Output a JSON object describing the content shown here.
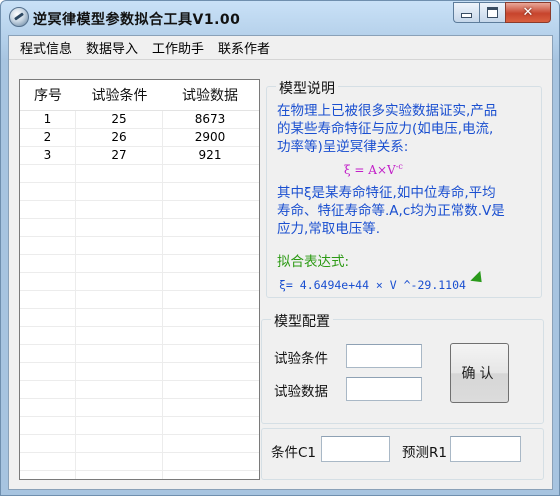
{
  "window": {
    "title": "逆冥律模型参数拟合工具V1.00",
    "close_glyph": "✕"
  },
  "menu": [
    "程式信息",
    "数据导入",
    "工作助手",
    "联系作者"
  ],
  "table": {
    "headers": [
      "序号",
      "试验条件",
      "试验数据"
    ],
    "rows": [
      [
        "1",
        "25",
        "8673"
      ],
      [
        "2",
        "26",
        "2900"
      ],
      [
        "3",
        "27",
        "921"
      ]
    ],
    "empty_rows": 18
  },
  "model_desc": {
    "group_title": "模型说明",
    "intro": [
      "在物理上已被很多实验数据证实,产品",
      "的某些寿命特征与应力(如电压,电流,",
      "功率等)呈逆冥律关系:"
    ],
    "formula": "ξ = A×V",
    "formula_exp": "-c",
    "explain": [
      "其中ξ是某寿命特征,如中位寿命,平均",
      "寿命、特征寿命等.A,c均为正常数.V是",
      "应力,常取电压等."
    ],
    "fit_label": "拟合表达式:",
    "fit_expr": "ξ= 4.6494e+44 × V ^-29.1104"
  },
  "model_config": {
    "group_title": "模型配置",
    "condition_label": "试验条件",
    "data_label": "试验数据",
    "condition_value": "",
    "data_value": "",
    "confirm_label": "确认"
  },
  "predict": {
    "condition_label": "条件C1",
    "predict_label": "预测R1",
    "condition_value": "",
    "predict_value": ""
  }
}
